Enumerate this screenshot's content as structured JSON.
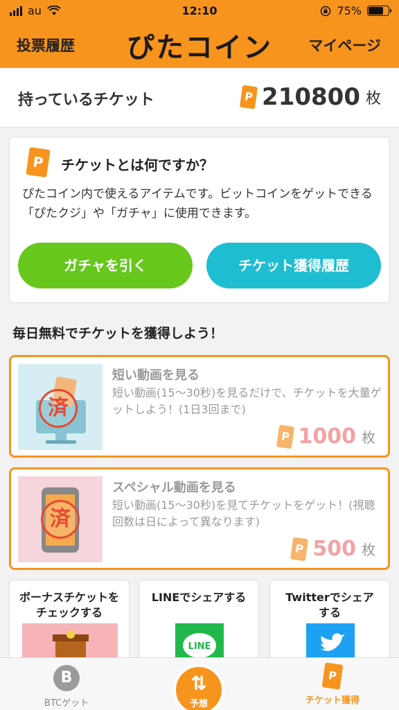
{
  "status": {
    "carrier": "au",
    "time": "12:10",
    "battery": "75%"
  },
  "header": {
    "left_label": "投票履歴",
    "logo": "ぴたコイン",
    "right_label": "マイページ"
  },
  "ticket_summary": {
    "label": "持っているチケット",
    "count": "210800",
    "unit": "枚",
    "icon_letter": "P"
  },
  "info": {
    "title": "チケットとは何ですか？",
    "description": "ぴたコイン内で使えるアイテムです。ビットコインをゲットできる「ぴたクジ」や「ガチャ」に使用できます。",
    "button_gacha": "ガチャを引く",
    "button_history": "チケット獲得履歴"
  },
  "section_title": "毎日無料でチケットを獲得しよう！",
  "cards": [
    {
      "title": "短い動画を見る",
      "description": "短い動画(15〜30秒)を見るだけで、チケットを大量ゲットしよう！(1日3回まで)",
      "reward": "1000",
      "unit": "枚",
      "stamp": "済"
    },
    {
      "title": "スペシャル動画を見る",
      "description": "短い動画(15〜30秒)を見てチケットをゲット！(視聴回数は日によって異なります)",
      "reward": "500",
      "unit": "枚",
      "stamp": "済"
    }
  ],
  "tiles": [
    {
      "label": "ボーナスチケットを\nチェックする"
    },
    {
      "label": "LINEでシェアする",
      "logo_text": "LINE"
    },
    {
      "label": "Twitterでシェア\nする"
    }
  ],
  "tabbar": {
    "btc": {
      "icon_letter": "B",
      "label": "BTCゲット"
    },
    "center": {
      "label": "予想"
    },
    "ticket": {
      "label": "チケット獲得"
    }
  },
  "colors": {
    "brand_orange": "#f7941d",
    "green_button": "#67c71d",
    "blue_button": "#1ebdd2",
    "stamp_red": "#e6492f"
  },
  "icons": [
    "signal-icon",
    "wifi-icon",
    "lock-rotation-icon",
    "battery-icon",
    "ticket-p-icon",
    "bitcoin-icon",
    "swap-arrows-icon",
    "twitter-bird-icon",
    "line-logo-icon"
  ]
}
